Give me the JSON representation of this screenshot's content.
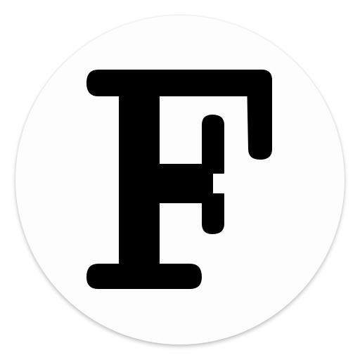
{
  "logo": {
    "letter": "F",
    "icon": "letter-f-logo-icon",
    "badge_color": "#fdfdfd",
    "glyph_color": "#000000"
  }
}
